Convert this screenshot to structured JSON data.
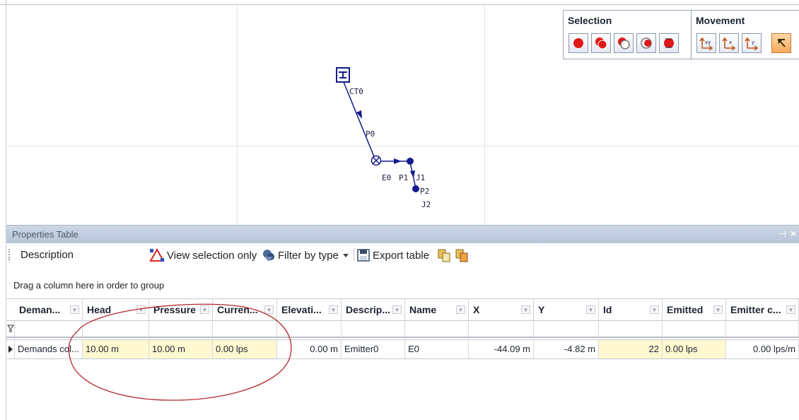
{
  "network": {
    "labels": {
      "ct0": "CT0",
      "p0": "P0",
      "e0": "E0",
      "p1": "P1",
      "j1": "J1",
      "p2": "P2",
      "j2": "J2"
    }
  },
  "toolbox": {
    "selection_title": "Selection",
    "movement_title": "Movement",
    "selection_icons": [
      "select-point-icon",
      "select-filled-icon",
      "select-outline-icon",
      "select-toggle-icon",
      "select-swap-icon"
    ],
    "movement_icons": [
      "move-xy-icon",
      "move-x-icon",
      "move-y-icon",
      "pointer-mode-icon"
    ]
  },
  "properties": {
    "title": "Properties Table",
    "pin_glyph": "⊣",
    "close_glyph": "×",
    "description_label": "Description",
    "view_selection_only": "View selection only",
    "filter_by_type": "Filter by type",
    "export_table": "Export table",
    "group_hint": "Drag a column here in order to group",
    "columns": [
      "Deman...",
      "Head",
      "Pressure",
      "Curren...",
      "Elevati...",
      "Descrip...",
      "Name",
      "X",
      "Y",
      "Id",
      "Emitted",
      "Emitter c..."
    ],
    "rows": [
      {
        "cells": [
          "Demands col...",
          "10.00 m",
          "10.00 m",
          "0.00 lps",
          "0.00 m",
          "Emitter0",
          "E0",
          "-44.09 m",
          "-4.82 m",
          "22",
          "0.00 lps",
          "0.00 lps/m"
        ]
      }
    ]
  },
  "colors": {
    "network_blue": "#141a8c",
    "annotation_red": "#b2282d",
    "highlight_yellow": "#fff8d0",
    "active_orange": "#f6a95a"
  }
}
